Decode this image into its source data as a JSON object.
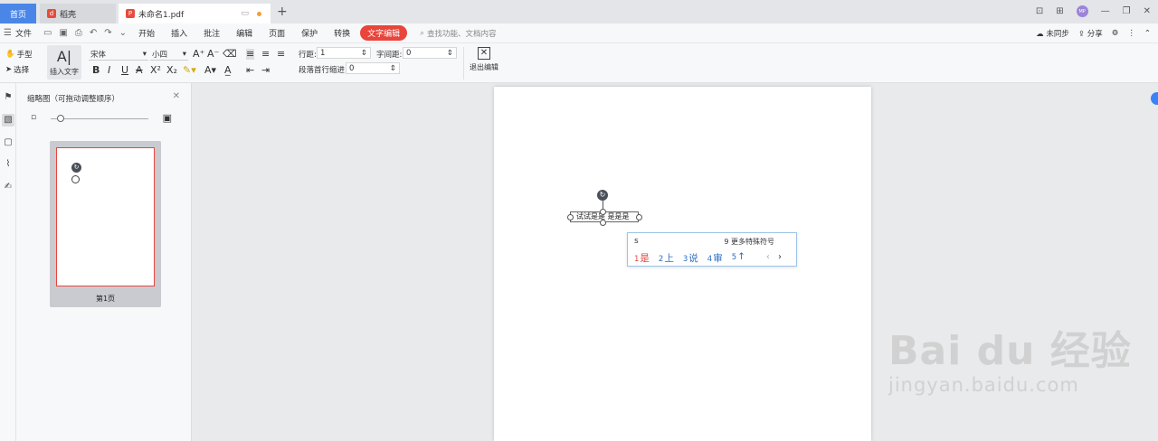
{
  "tabs": {
    "home": "首页",
    "daoke": "稻壳",
    "doc": "未命名1.pdf",
    "add": "+"
  },
  "menu": {
    "file": "文件",
    "items": [
      "开始",
      "插入",
      "批注",
      "编辑",
      "页面",
      "保护",
      "转换"
    ],
    "active": "文字编辑",
    "search_placeholder": "查找功能、文档内容",
    "sync": "未同步",
    "share": "分享"
  },
  "ribbon": {
    "hand": "手型",
    "select": "选择",
    "insert_text": "插入文字",
    "font_name": "宋体",
    "font_size": "小四",
    "line_spacing_label": "行距:",
    "line_spacing_value": "1",
    "char_spacing_label": "字间距:",
    "char_spacing_value": "0",
    "indent_label": "段落首行缩进:",
    "indent_value": "0",
    "exit_edit": "退出编辑"
  },
  "thumbnails": {
    "title": "缩略图（可拖动调整顺序）",
    "page_label": "第1页",
    "zoom_level": 0.1
  },
  "document": {
    "textbox_text": "试试是是 是是是"
  },
  "ime": {
    "input": "s",
    "more": "9 更多特殊符号",
    "candidates": [
      {
        "num": "1",
        "char": "是"
      },
      {
        "num": "2",
        "char": "上"
      },
      {
        "num": "3",
        "char": "说"
      },
      {
        "num": "4",
        "char": "审"
      },
      {
        "num": "5",
        "char": "↑"
      }
    ],
    "prev": "‹",
    "next": "›"
  },
  "watermark": {
    "main": "Bai du 经验",
    "sub": "jingyan.baidu.com"
  }
}
